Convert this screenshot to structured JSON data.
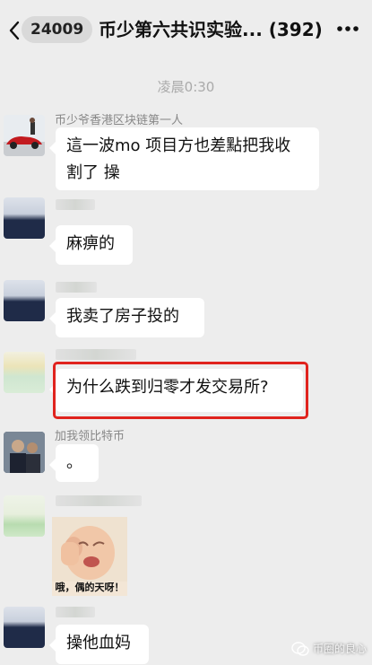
{
  "header": {
    "unread_count": "24009",
    "title": "币少第六共识实验... (392)"
  },
  "timestamp": "凌晨0:30",
  "messages": [
    {
      "sender": "币少爷香港区块链第一人",
      "text": "這一波mo 项目方也差點把我收割了 操",
      "line1": "這一波mo 项目方也差點把我收",
      "line2": "割了 操"
    },
    {
      "sender": "",
      "text": "麻痹的"
    },
    {
      "sender": "",
      "text": "我卖了房子投的"
    },
    {
      "sender": "",
      "text": "为什么跌到归零才发交易所?"
    },
    {
      "sender": "加我领比特币",
      "text": "。"
    },
    {
      "sender": "",
      "sticker_caption": "哦，偶的天呀！"
    },
    {
      "sender": "",
      "text": "操他血妈"
    }
  ],
  "watermark": "币圈的良心",
  "colors": {
    "background": "#ededed",
    "bubble": "#ffffff",
    "highlight": "#e0231e"
  }
}
